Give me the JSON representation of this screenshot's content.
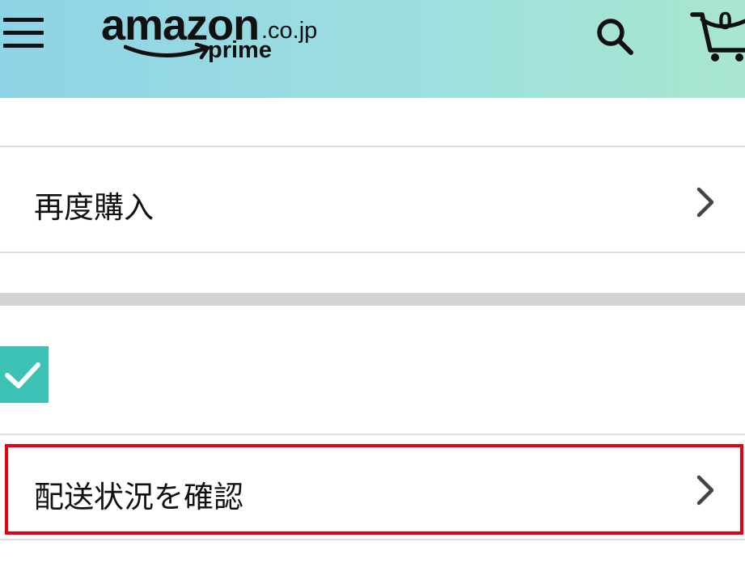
{
  "header": {
    "logo": {
      "word": "amazon",
      "tld": ".co.jp",
      "tagline": "prime"
    },
    "menu_icon": "hamburger-menu-icon",
    "search_icon": "search-icon",
    "cart_icon": "cart-icon",
    "cart_count": "0"
  },
  "rows": {
    "buy_again": {
      "label": "再度購入"
    },
    "track_package": {
      "label": "配送状況を確認"
    }
  },
  "checkbox": {
    "checked": true,
    "icon": "checkmark-icon"
  },
  "colors": {
    "header_gradient_start": "#8fd3e6",
    "header_gradient_end": "#a8e6cf",
    "checkbox": "#3cc2b4",
    "highlight_border": "#e30012",
    "divider": "#dcdcdc",
    "section_separator": "#d3d3d3"
  }
}
